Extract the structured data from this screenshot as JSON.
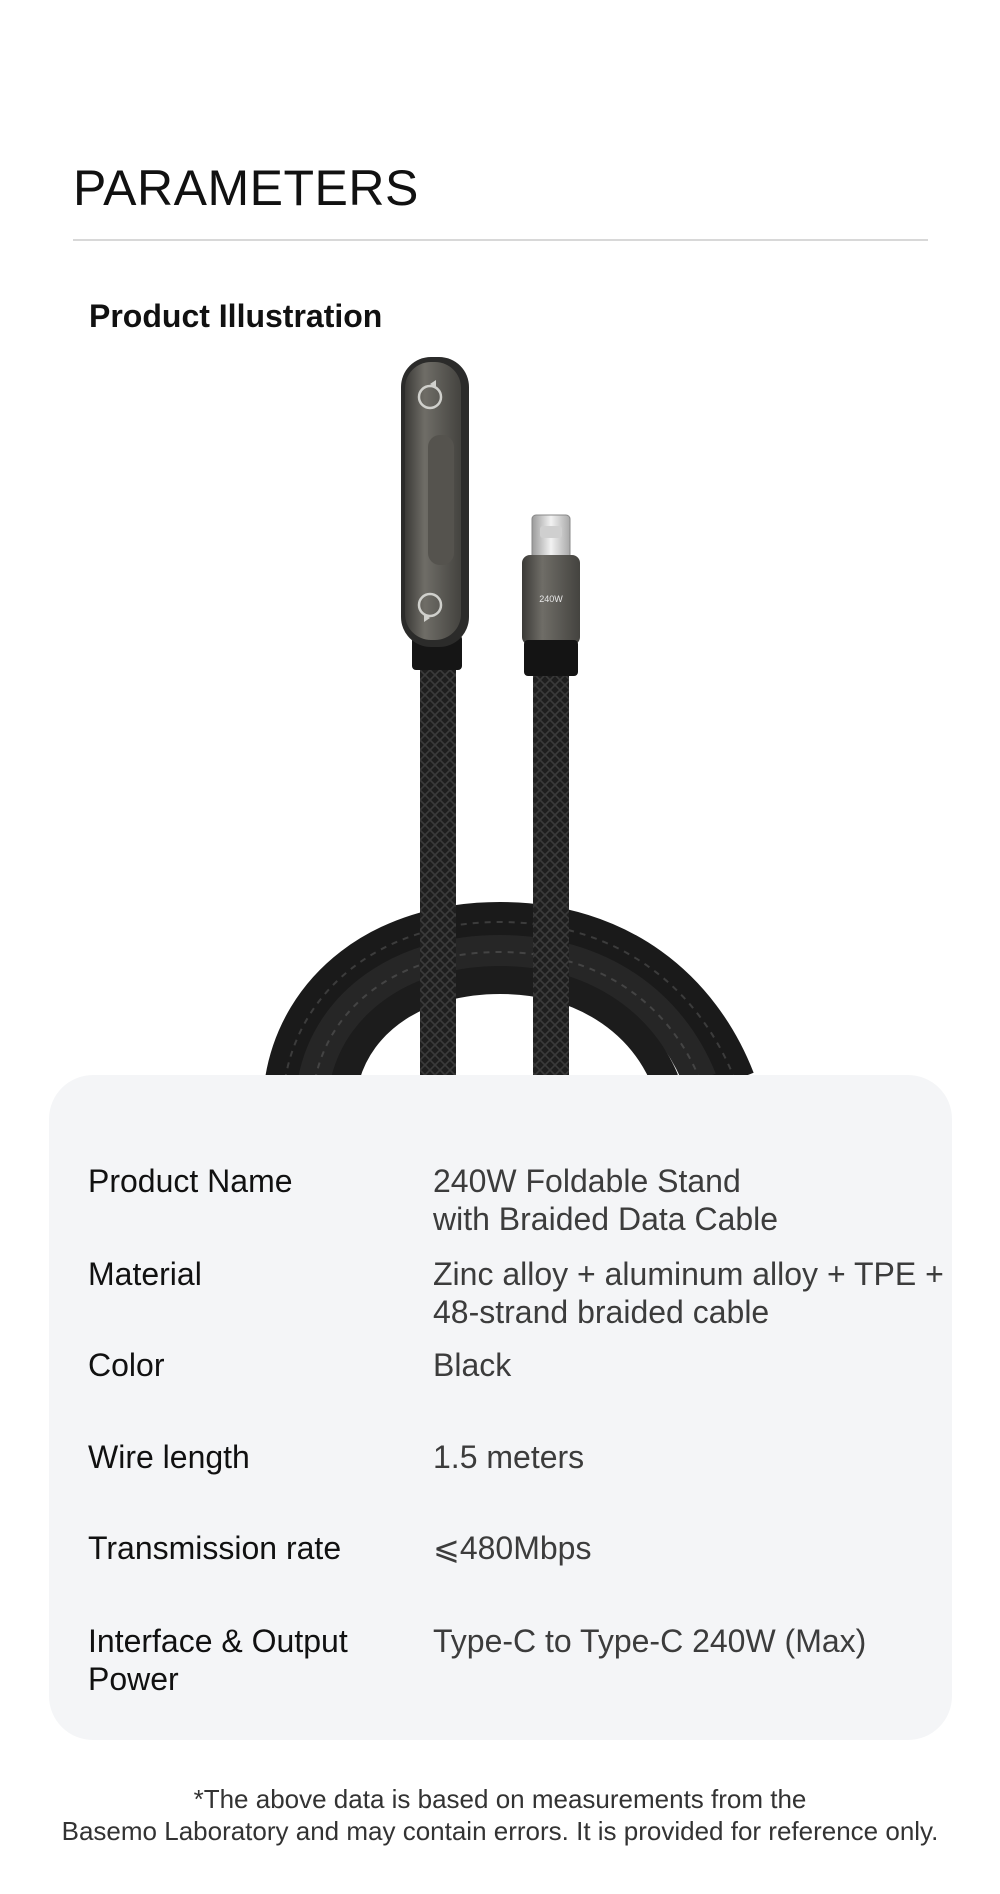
{
  "header": {
    "title": "PARAMETERS",
    "subtitle": "Product Illustration"
  },
  "illustration": {
    "connector_label": "240W",
    "cable_color": "#1c1c1c",
    "housing_color": "#5e5d58"
  },
  "specs": [
    {
      "label": "Product Name",
      "value_lines": [
        "240W Foldable Stand",
        "with Braided Data Cable"
      ]
    },
    {
      "label": "Material",
      "value_lines": [
        "Zinc alloy + aluminum alloy + TPE +",
        "48-strand braided cable"
      ]
    },
    {
      "label": "Color",
      "value_lines": [
        "Black"
      ]
    },
    {
      "label": "Wire length",
      "value_lines": [
        "1.5 meters"
      ]
    },
    {
      "label": "Transmission rate",
      "value_lines": [
        "⩽480Mbps"
      ]
    },
    {
      "label_lines": [
        "Interface & Output",
        "Power"
      ],
      "value_lines": [
        "Type-C to Type-C 240W (Max)"
      ]
    }
  ],
  "footnote": {
    "line1": "*The above data is based on measurements from the",
    "line2": "Basemo Laboratory and may contain errors. It is provided for reference only."
  }
}
